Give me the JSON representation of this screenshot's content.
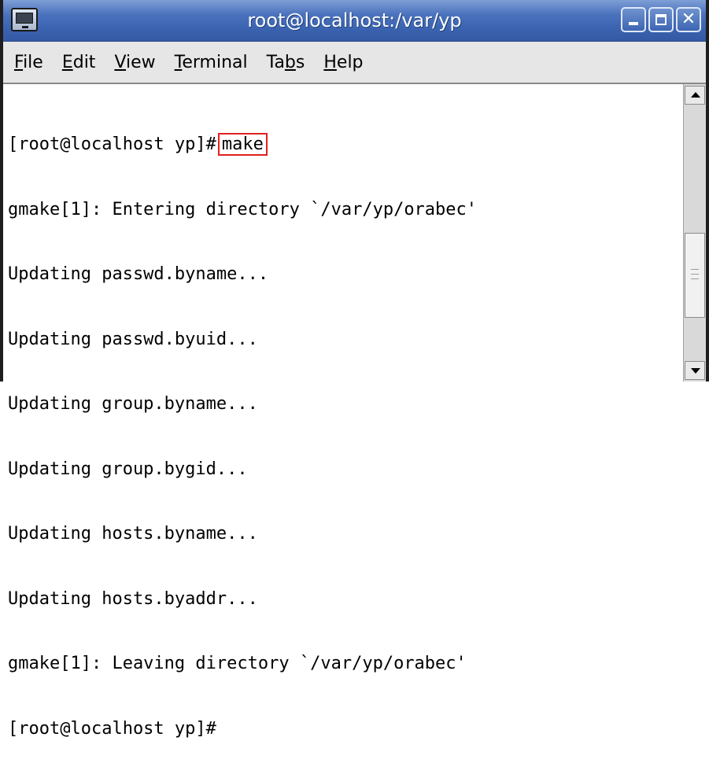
{
  "window": {
    "title": "root@localhost:/var/yp",
    "icon": "terminal-icon",
    "controls": [
      "minimize",
      "maximize",
      "close"
    ],
    "close_glyph": "✕"
  },
  "menubar": {
    "items": [
      {
        "pre": "",
        "mn": "F",
        "post": "ile"
      },
      {
        "pre": "",
        "mn": "E",
        "post": "dit"
      },
      {
        "pre": "",
        "mn": "V",
        "post": "iew"
      },
      {
        "pre": "",
        "mn": "T",
        "post": "erminal"
      },
      {
        "pre": "Ta",
        "mn": "b",
        "post": "s"
      },
      {
        "pre": "",
        "mn": "H",
        "post": "elp"
      }
    ]
  },
  "terminal": {
    "prompt": "[root@localhost yp]#",
    "command": "make",
    "output": [
      "gmake[1]: Entering directory `/var/yp/orabec'",
      "Updating passwd.byname...",
      "Updating passwd.byuid...",
      "Updating group.byname...",
      "Updating group.bygid...",
      "Updating hosts.byname...",
      "Updating hosts.byaddr...",
      "gmake[1]: Leaving directory `/var/yp/orabec'"
    ],
    "final_prompt": "[root@localhost yp]#"
  },
  "colors": {
    "titlebar": "#3a63b0",
    "highlight_box": "#e02020"
  }
}
